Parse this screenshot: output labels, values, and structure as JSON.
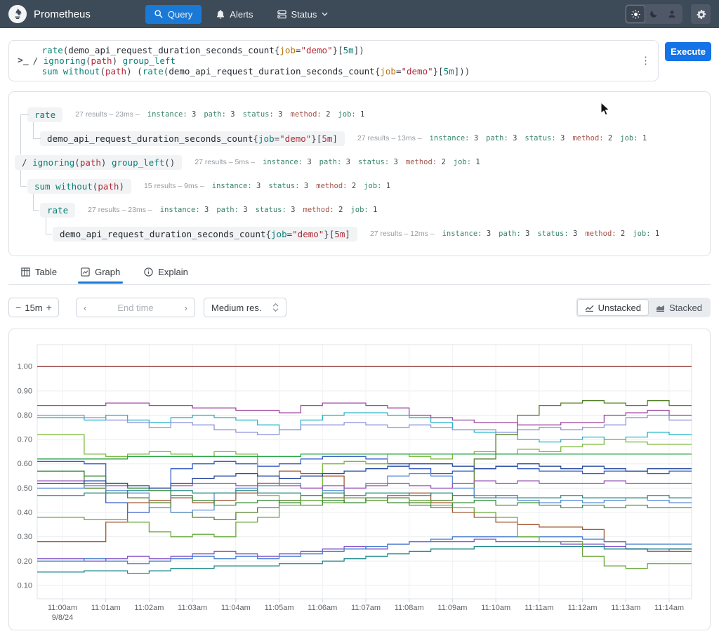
{
  "navbar": {
    "brand": "Prometheus",
    "query_label": "Query",
    "alerts_label": "Alerts",
    "status_label": "Status",
    "colors": {
      "bar": "#3d4a57",
      "active_btn": "#1b79d6"
    }
  },
  "editor": {
    "execute_label": "Execute",
    "kebab": "⋮",
    "prompt": ">_",
    "lines": [
      [
        {
          "t": "rate",
          "c": "fn"
        },
        {
          "t": "(",
          "c": "pn"
        },
        {
          "t": "demo_api_request_duration_seconds_count",
          "c": "mt"
        },
        {
          "t": "{",
          "c": "pn"
        },
        {
          "t": "job",
          "c": "lab"
        },
        {
          "t": "=",
          "c": "pn"
        },
        {
          "t": "\"demo\"",
          "c": "red"
        },
        {
          "t": "}",
          "c": "pn"
        },
        {
          "t": "[",
          "c": "pn"
        },
        {
          "t": "5m",
          "c": "dur"
        },
        {
          "t": "]",
          "c": "pn"
        },
        {
          "t": ")",
          "c": "pn"
        }
      ],
      [
        {
          "t": "/ ",
          "c": "op"
        },
        {
          "t": "ignoring",
          "c": "fn"
        },
        {
          "t": "(",
          "c": "pn"
        },
        {
          "t": "path",
          "c": "red"
        },
        {
          "t": ")",
          "c": "pn"
        },
        {
          "t": " ",
          "c": "pn"
        },
        {
          "t": "group_left",
          "c": "fn"
        }
      ],
      [
        {
          "t": "sum",
          "c": "fn"
        },
        {
          "t": " ",
          "c": "pn"
        },
        {
          "t": "without",
          "c": "fn"
        },
        {
          "t": "(",
          "c": "pn"
        },
        {
          "t": "path",
          "c": "red"
        },
        {
          "t": ")",
          "c": "pn"
        },
        {
          "t": " (",
          "c": "pn"
        },
        {
          "t": "rate",
          "c": "fn"
        },
        {
          "t": "(",
          "c": "pn"
        },
        {
          "t": "demo_api_request_duration_seconds_count",
          "c": "mt"
        },
        {
          "t": "{",
          "c": "pn"
        },
        {
          "t": "job",
          "c": "lab"
        },
        {
          "t": "=",
          "c": "pn"
        },
        {
          "t": "\"demo\"",
          "c": "red"
        },
        {
          "t": "}",
          "c": "pn"
        },
        {
          "t": "[",
          "c": "pn"
        },
        {
          "t": "5m",
          "c": "dur"
        },
        {
          "t": "]",
          "c": "pn"
        },
        {
          "t": "))",
          "c": "pn"
        }
      ]
    ]
  },
  "tree": {
    "rows": [
      {
        "depth": 1,
        "chip": [
          {
            "t": "rate",
            "c": "fn"
          }
        ],
        "results": "27 results",
        "time": "23ms",
        "labels": [
          {
            "n": "instance",
            "v": "3"
          },
          {
            "n": "path",
            "v": "3"
          },
          {
            "n": "status",
            "v": "3"
          },
          {
            "n": "method",
            "v": "2"
          },
          {
            "n": "job",
            "v": "1"
          }
        ]
      },
      {
        "depth": 2,
        "chip": [
          {
            "t": "demo_api_request_duration_seconds_count",
            "c": "mt"
          },
          {
            "t": "{",
            "c": "pn"
          },
          {
            "t": "job",
            "c": "fn"
          },
          {
            "t": "=",
            "c": "pn"
          },
          {
            "t": "\"demo\"",
            "c": "red"
          },
          {
            "t": "}",
            "c": "pn"
          },
          {
            "t": "[",
            "c": "pn"
          },
          {
            "t": "5m",
            "c": "red"
          },
          {
            "t": "]",
            "c": "pn"
          }
        ],
        "results": "27 results",
        "time": "13ms",
        "labels": [
          {
            "n": "instance",
            "v": "3"
          },
          {
            "n": "path",
            "v": "3"
          },
          {
            "n": "status",
            "v": "3"
          },
          {
            "n": "method",
            "v": "2"
          },
          {
            "n": "job",
            "v": "1"
          }
        ]
      },
      {
        "depth": 0,
        "chip": [
          {
            "t": "/ ",
            "c": "op"
          },
          {
            "t": "ignoring",
            "c": "fn"
          },
          {
            "t": "(",
            "c": "pn"
          },
          {
            "t": "path",
            "c": "red"
          },
          {
            "t": ")",
            "c": "pn"
          },
          {
            "t": " ",
            "c": "pn"
          },
          {
            "t": "group_left",
            "c": "fn"
          },
          {
            "t": "()",
            "c": "pn"
          }
        ],
        "results": "27 results",
        "time": "5ms",
        "labels": [
          {
            "n": "instance",
            "v": "3"
          },
          {
            "n": "path",
            "v": "3"
          },
          {
            "n": "status",
            "v": "3"
          },
          {
            "n": "method",
            "v": "2"
          },
          {
            "n": "job",
            "v": "1"
          }
        ]
      },
      {
        "depth": 1,
        "chip": [
          {
            "t": "sum",
            "c": "fn"
          },
          {
            "t": " ",
            "c": "pn"
          },
          {
            "t": "without",
            "c": "fn"
          },
          {
            "t": "(",
            "c": "pn"
          },
          {
            "t": "path",
            "c": "red"
          },
          {
            "t": ")",
            "c": "pn"
          }
        ],
        "results": "15 results",
        "time": "9ms",
        "labels": [
          {
            "n": "instance",
            "v": "3"
          },
          {
            "n": "status",
            "v": "3"
          },
          {
            "n": "method",
            "v": "2"
          },
          {
            "n": "job",
            "v": "1"
          }
        ]
      },
      {
        "depth": 2,
        "chip": [
          {
            "t": "rate",
            "c": "fn"
          }
        ],
        "results": "27 results",
        "time": "23ms",
        "labels": [
          {
            "n": "instance",
            "v": "3"
          },
          {
            "n": "path",
            "v": "3"
          },
          {
            "n": "status",
            "v": "3"
          },
          {
            "n": "method",
            "v": "2"
          },
          {
            "n": "job",
            "v": "1"
          }
        ]
      },
      {
        "depth": 3,
        "chip": [
          {
            "t": "demo_api_request_duration_seconds_count",
            "c": "mt"
          },
          {
            "t": "{",
            "c": "pn"
          },
          {
            "t": "job",
            "c": "fn"
          },
          {
            "t": "=",
            "c": "pn"
          },
          {
            "t": "\"demo\"",
            "c": "red"
          },
          {
            "t": "}",
            "c": "pn"
          },
          {
            "t": "[",
            "c": "pn"
          },
          {
            "t": "5m",
            "c": "red"
          },
          {
            "t": "]",
            "c": "pn"
          }
        ],
        "results": "27 results",
        "time": "12ms",
        "labels": [
          {
            "n": "instance",
            "v": "3"
          },
          {
            "n": "path",
            "v": "3"
          },
          {
            "n": "status",
            "v": "3"
          },
          {
            "n": "method",
            "v": "2"
          },
          {
            "n": "job",
            "v": "1"
          }
        ]
      }
    ]
  },
  "tabs": {
    "table": "Table",
    "graph": "Graph",
    "explain": "Explain"
  },
  "controls": {
    "range": "15m",
    "minus": "−",
    "plus": "+",
    "endtime_placeholder": "End time",
    "prev": "‹",
    "next": "›",
    "resolution": "Medium res.",
    "unstacked": "Unstacked",
    "stacked": "Stacked"
  },
  "chart_data": {
    "type": "line",
    "step": true,
    "title": "",
    "xlabel": "",
    "ylabel": "",
    "x_ticks": [
      "11:00am",
      "11:01am",
      "11:02am",
      "11:03am",
      "11:04am",
      "11:05am",
      "11:06am",
      "11:07am",
      "11:08am",
      "11:09am",
      "11:10am",
      "11:11am",
      "11:12am",
      "11:13am",
      "11:14am"
    ],
    "x_date": "9/8/24",
    "y_ticks": [
      "1.00",
      "0.90",
      "0.80",
      "0.70",
      "0.60",
      "0.50",
      "0.40",
      "0.30",
      "0.20",
      "0.10"
    ],
    "ylim": [
      0.045,
      1.09
    ],
    "x_step_minutes": 0.5,
    "grid": true,
    "legend": "none",
    "series": [
      {
        "color": "#8a3533",
        "values": [
          1,
          1,
          1,
          1,
          1,
          1,
          1,
          1,
          1,
          1,
          1,
          1,
          1,
          1,
          1,
          1,
          1,
          1,
          1,
          1,
          1,
          1,
          1,
          1,
          1,
          1,
          1,
          1,
          1
        ]
      },
      {
        "color": "#a04ba0",
        "values": [
          0.84,
          0.84,
          0.85,
          0.85,
          0.84,
          0.84,
          0.83,
          0.83,
          0.82,
          0.82,
          0.81,
          0.84,
          0.85,
          0.85,
          0.84,
          0.83,
          0.8,
          0.79,
          0.78,
          0.77,
          0.77,
          0.76,
          0.76,
          0.77,
          0.77,
          0.8,
          0.81,
          0.82,
          0.8
        ]
      },
      {
        "color": "#2ab6c9",
        "values": [
          0.79,
          0.78,
          0.8,
          0.78,
          0.77,
          0.79,
          0.8,
          0.79,
          0.78,
          0.76,
          0.74,
          0.78,
          0.8,
          0.81,
          0.81,
          0.8,
          0.79,
          0.77,
          0.74,
          0.73,
          0.72,
          0.7,
          0.69,
          0.7,
          0.71,
          0.7,
          0.71,
          0.73,
          0.72
        ]
      },
      {
        "color": "#8d94da",
        "values": [
          0.8,
          0.79,
          0.78,
          0.77,
          0.75,
          0.77,
          0.76,
          0.74,
          0.73,
          0.72,
          0.74,
          0.76,
          0.76,
          0.77,
          0.76,
          0.75,
          0.76,
          0.75,
          0.74,
          0.74,
          0.73,
          0.74,
          0.75,
          0.74,
          0.75,
          0.76,
          0.79,
          0.8,
          0.78
        ]
      },
      {
        "color": "#3a5fc8",
        "values": [
          0.61,
          0.6,
          0.44,
          0.4,
          0.42,
          0.58,
          0.6,
          0.61,
          0.6,
          0.59,
          0.6,
          0.62,
          0.63,
          0.63,
          0.62,
          0.6,
          0.58,
          0.56,
          0.57,
          0.58,
          0.59,
          0.58,
          0.57,
          0.57,
          0.56,
          0.57,
          0.57,
          0.56,
          0.57
        ]
      },
      {
        "color": "#7fb93d",
        "values": [
          0.72,
          0.64,
          0.63,
          0.64,
          0.65,
          0.64,
          0.63,
          0.65,
          0.64,
          0.47,
          0.44,
          0.45,
          0.6,
          0.61,
          0.6,
          0.64,
          0.63,
          0.62,
          0.64,
          0.65,
          0.64,
          0.66,
          0.65,
          0.67,
          0.68,
          0.7,
          0.69,
          0.68,
          0.68
        ]
      },
      {
        "color": "#27a348",
        "values": [
          0.62,
          0.62,
          0.62,
          0.63,
          0.63,
          0.63,
          0.63,
          0.63,
          0.63,
          0.63,
          0.63,
          0.64,
          0.64,
          0.64,
          0.64,
          0.64,
          0.64,
          0.64,
          0.64,
          0.64,
          0.64,
          0.64,
          0.64,
          0.64,
          0.64,
          0.64,
          0.64,
          0.64,
          0.64
        ]
      },
      {
        "color": "#55802b",
        "values": [
          0.57,
          0.5,
          0.48,
          0.46,
          0.44,
          0.4,
          0.38,
          0.37,
          0.4,
          0.42,
          0.45,
          0.47,
          0.46,
          0.44,
          0.45,
          0.46,
          0.44,
          0.45,
          0.47,
          0.62,
          0.72,
          0.8,
          0.84,
          0.85,
          0.86,
          0.85,
          0.84,
          0.86,
          0.84
        ]
      },
      {
        "color": "#a05a34",
        "values": [
          0.28,
          0.28,
          0.36,
          0.44,
          0.45,
          0.46,
          0.44,
          0.45,
          0.48,
          0.52,
          0.57,
          0.56,
          0.55,
          0.46,
          0.45,
          0.47,
          0.48,
          0.44,
          0.4,
          0.38,
          0.36,
          0.35,
          0.34,
          0.34,
          0.33,
          0.28,
          0.25,
          0.24,
          0.24
        ]
      },
      {
        "color": "#8757c9",
        "values": [
          0.21,
          0.2,
          0.21,
          0.22,
          0.21,
          0.22,
          0.23,
          0.24,
          0.23,
          0.22,
          0.23,
          0.24,
          0.25,
          0.26,
          0.25,
          0.27,
          0.28,
          0.28,
          0.28,
          0.29,
          0.28,
          0.28,
          0.28,
          0.27,
          0.27,
          0.26,
          0.25,
          0.24,
          0.25
        ]
      },
      {
        "color": "#4780cf",
        "values": [
          0.2,
          0.21,
          0.2,
          0.19,
          0.2,
          0.21,
          0.22,
          0.21,
          0.22,
          0.21,
          0.22,
          0.23,
          0.24,
          0.25,
          0.26,
          0.27,
          0.28,
          0.29,
          0.3,
          0.3,
          0.3,
          0.3,
          0.3,
          0.3,
          0.29,
          0.28,
          0.27,
          0.27,
          0.27
        ]
      },
      {
        "color": "#1f8a8a",
        "values": [
          0.155,
          0.16,
          0.16,
          0.15,
          0.16,
          0.17,
          0.17,
          0.18,
          0.18,
          0.18,
          0.19,
          0.19,
          0.2,
          0.21,
          0.22,
          0.23,
          0.24,
          0.25,
          0.25,
          0.26,
          0.26,
          0.26,
          0.26,
          0.26,
          0.26,
          0.25,
          0.25,
          0.25,
          0.25
        ]
      },
      {
        "color": "#6aa83c",
        "values": [
          0.38,
          0.37,
          0.37,
          0.36,
          0.32,
          0.3,
          0.31,
          0.3,
          0.36,
          0.38,
          0.43,
          0.45,
          0.44,
          0.46,
          0.45,
          0.44,
          0.45,
          0.43,
          0.42,
          0.4,
          0.38,
          0.3,
          0.28,
          0.28,
          0.22,
          0.18,
          0.17,
          0.19,
          0.19
        ]
      },
      {
        "color": "#5b8ed6",
        "values": [
          0.5,
          0.51,
          0.49,
          0.48,
          0.42,
          0.4,
          0.41,
          0.48,
          0.5,
          0.51,
          0.52,
          0.5,
          0.49,
          0.5,
          0.52,
          0.55,
          0.56,
          0.55,
          0.5,
          0.47,
          0.46,
          0.45,
          0.44,
          0.45,
          0.44,
          0.45,
          0.46,
          0.45,
          0.44
        ]
      },
      {
        "color": "#9b59b6",
        "values": [
          0.53,
          0.52,
          0.51,
          0.5,
          0.5,
          0.51,
          0.52,
          0.52,
          0.51,
          0.52,
          0.51,
          0.5,
          0.51,
          0.5,
          0.51,
          0.52,
          0.51,
          0.5,
          0.52,
          0.53,
          0.52,
          0.53,
          0.52,
          0.52,
          0.52,
          0.53,
          0.52,
          0.52,
          0.52
        ]
      },
      {
        "color": "#2f8f85",
        "values": [
          0.47,
          0.48,
          0.48,
          0.49,
          0.5,
          0.49,
          0.48,
          0.48,
          0.49,
          0.48,
          0.48,
          0.47,
          0.48,
          0.47,
          0.48,
          0.48,
          0.47,
          0.48,
          0.47,
          0.46,
          0.47,
          0.46,
          0.46,
          0.47,
          0.46,
          0.46,
          0.46,
          0.47,
          0.46
        ]
      },
      {
        "color": "#3f8f3f",
        "values": [
          0.57,
          0.55,
          0.52,
          0.5,
          0.49,
          0.47,
          0.45,
          0.43,
          0.44,
          0.45,
          0.44,
          0.43,
          0.45,
          0.44,
          0.46,
          0.44,
          0.43,
          0.42,
          0.44,
          0.45,
          0.43,
          0.44,
          0.43,
          0.42,
          0.43,
          0.42,
          0.43,
          0.42,
          0.42
        ]
      },
      {
        "color": "#2c4ea0",
        "values": [
          0.52,
          0.53,
          0.52,
          0.51,
          0.5,
          0.52,
          0.54,
          0.55,
          0.56,
          0.55,
          0.54,
          0.55,
          0.56,
          0.57,
          0.58,
          0.59,
          0.6,
          0.6,
          0.59,
          0.58,
          0.59,
          0.6,
          0.59,
          0.58,
          0.59,
          0.58,
          0.57,
          0.58,
          0.58
        ]
      }
    ]
  }
}
